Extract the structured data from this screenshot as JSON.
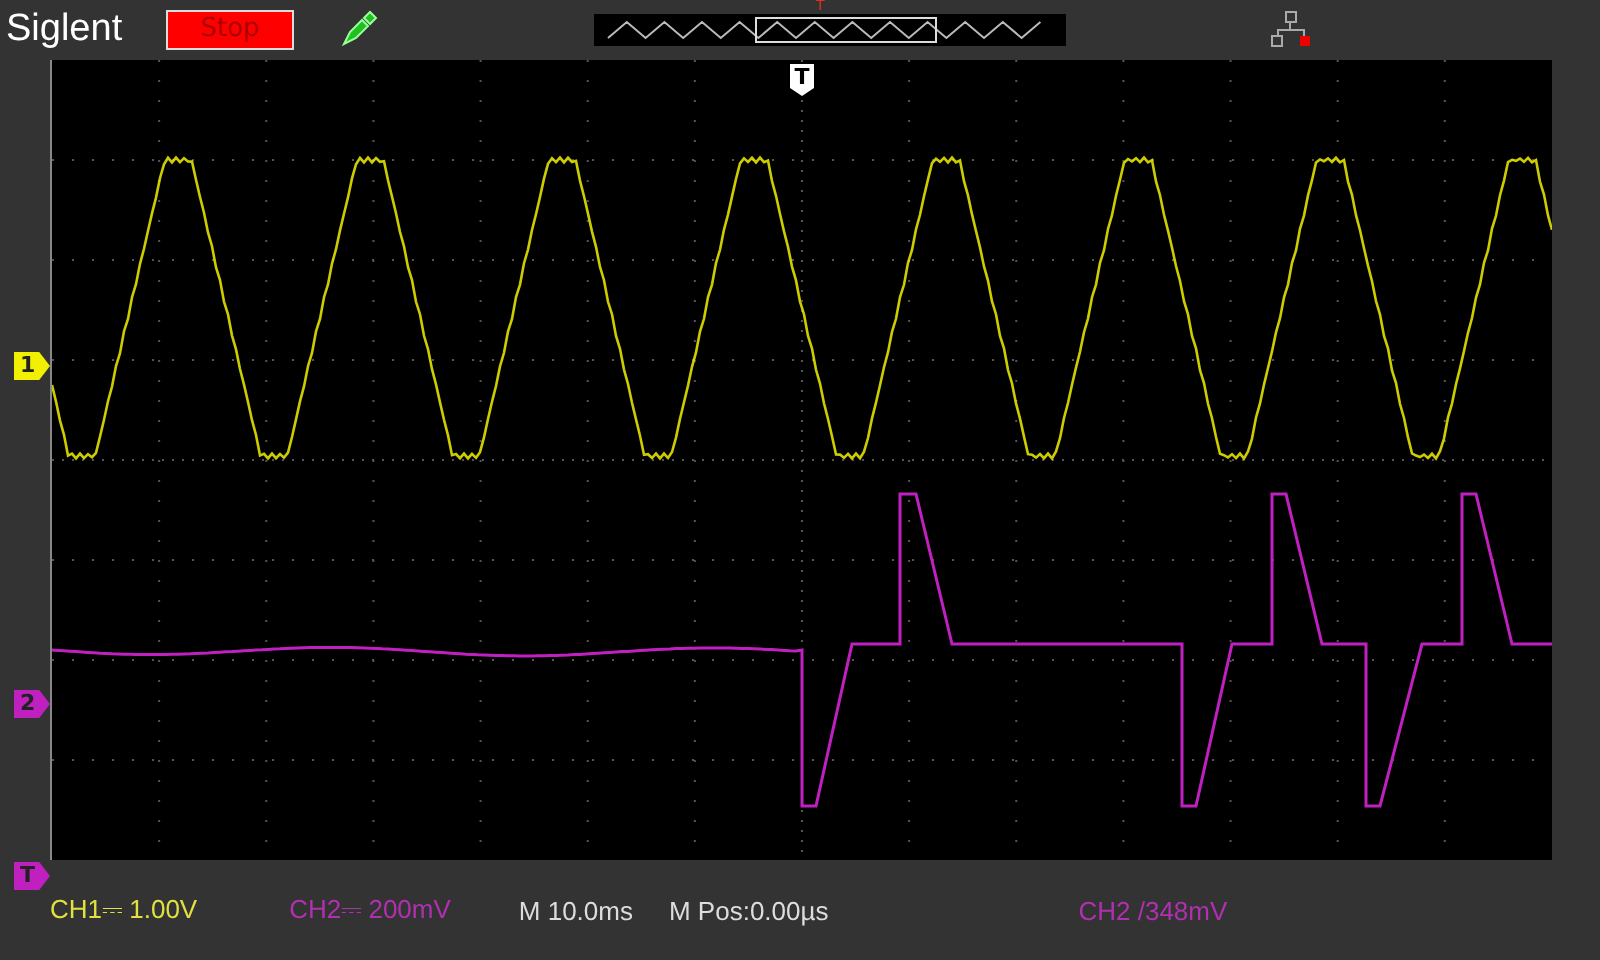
{
  "header": {
    "brand": "Siglent",
    "run_state": "Stop",
    "trigger_mark": "T"
  },
  "screen": {
    "trigger_position": "T",
    "markers": [
      {
        "label": "1",
        "kind": "channel",
        "color": "#f0f000"
      },
      {
        "label": "2",
        "kind": "channel",
        "color": "#c020c0"
      },
      {
        "label": "T",
        "kind": "trigger",
        "color": "#c020c0"
      }
    ]
  },
  "status_bar": {
    "ch1": {
      "label": "CH1",
      "coupling": "⎓",
      "scale": "1.00V",
      "color": "#e0e040"
    },
    "ch2": {
      "label": "CH2",
      "coupling": "⎓",
      "scale": "200mV",
      "color": "#b030b0"
    },
    "timebase": "M 10.0ms",
    "position": "M Pos:0.00µs",
    "trigger": {
      "source": "CH2",
      "slope": "/",
      "level": "348mV",
      "color": "#b030b0"
    }
  }
}
